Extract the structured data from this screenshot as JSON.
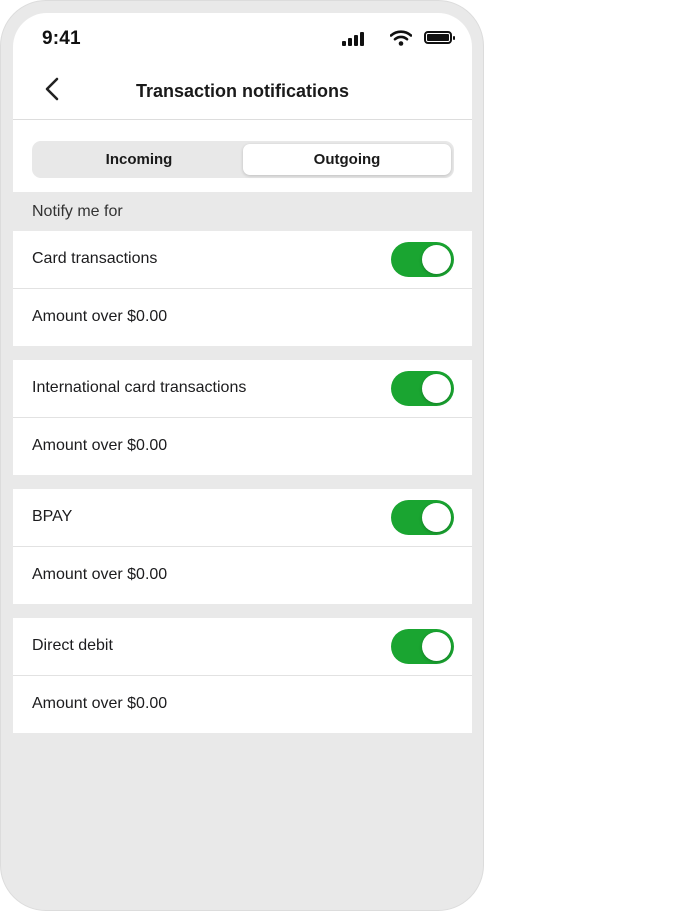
{
  "status_bar": {
    "time": "9:41"
  },
  "nav": {
    "title": "Transaction notifications"
  },
  "segments": {
    "incoming": "Incoming",
    "outgoing": "Outgoing",
    "selected": "Outgoing"
  },
  "section": {
    "header": "Notify me for"
  },
  "groups": [
    {
      "label": "Card transactions",
      "enabled": true,
      "amount": "Amount over $0.00"
    },
    {
      "label": "International card transactions",
      "enabled": true,
      "amount": "Amount over $0.00"
    },
    {
      "label": "BPAY",
      "enabled": true,
      "amount": "Amount over $0.00"
    },
    {
      "label": "Direct debit",
      "enabled": true,
      "amount": "Amount over $0.00"
    }
  ],
  "colors": {
    "toggle_on": "#1aa531",
    "background": "#e9e9e9"
  }
}
